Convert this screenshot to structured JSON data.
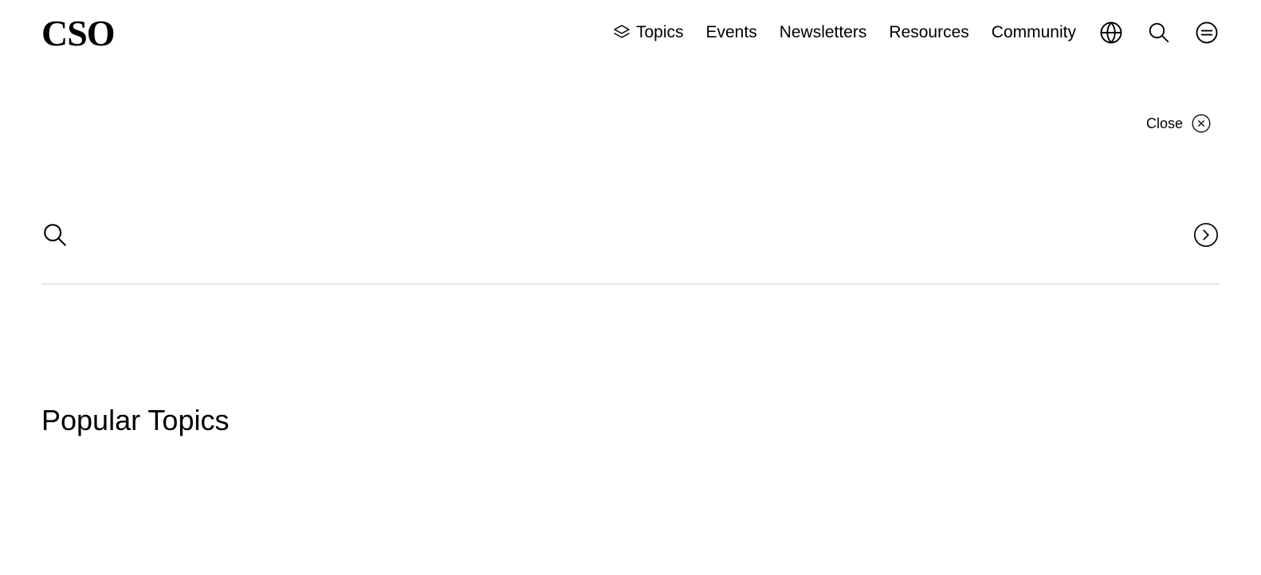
{
  "logo": "CSO",
  "nav": {
    "topics": "Topics",
    "events": "Events",
    "newsletters": "Newsletters",
    "resources": "Resources",
    "community": "Community"
  },
  "close": {
    "label": "Close"
  },
  "search": {
    "placeholder": ""
  },
  "popular": {
    "heading": "Popular Topics"
  }
}
